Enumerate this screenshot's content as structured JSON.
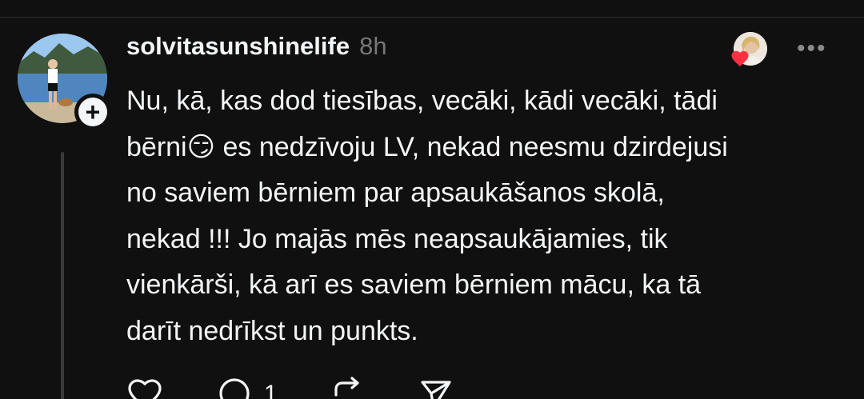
{
  "post": {
    "username": "solvitasunshinelife",
    "time": "8h",
    "text": "Nu, kā, kas dod tiesības, vecāki, kādi vecāki, tādi\nbērni😏 es nedzīvoju LV, nekad neesmu dzirdejusi\nno saviem bērniem par apsaukāšanos skolā,\nnekad !!! Jo majās mēs neapsaukājamies, tik\nvienkārši, kā arī es saviem bērniem mācu, ka tā\ndarīt nedrīkst un punkts.",
    "more_label": "•••",
    "follow_symbol": "+",
    "reply_count": "1"
  },
  "icons": {
    "like": "heart-outline-icon",
    "reply": "comment-bubble-icon",
    "repost": "repost-arrows-icon",
    "share": "send-icon",
    "liked": "heart-filled-icon"
  },
  "colors": {
    "background": "#101010",
    "text": "#f3f5f7",
    "muted": "#777777",
    "heart": "#ff3040",
    "thread_line": "#3a3a3a"
  }
}
